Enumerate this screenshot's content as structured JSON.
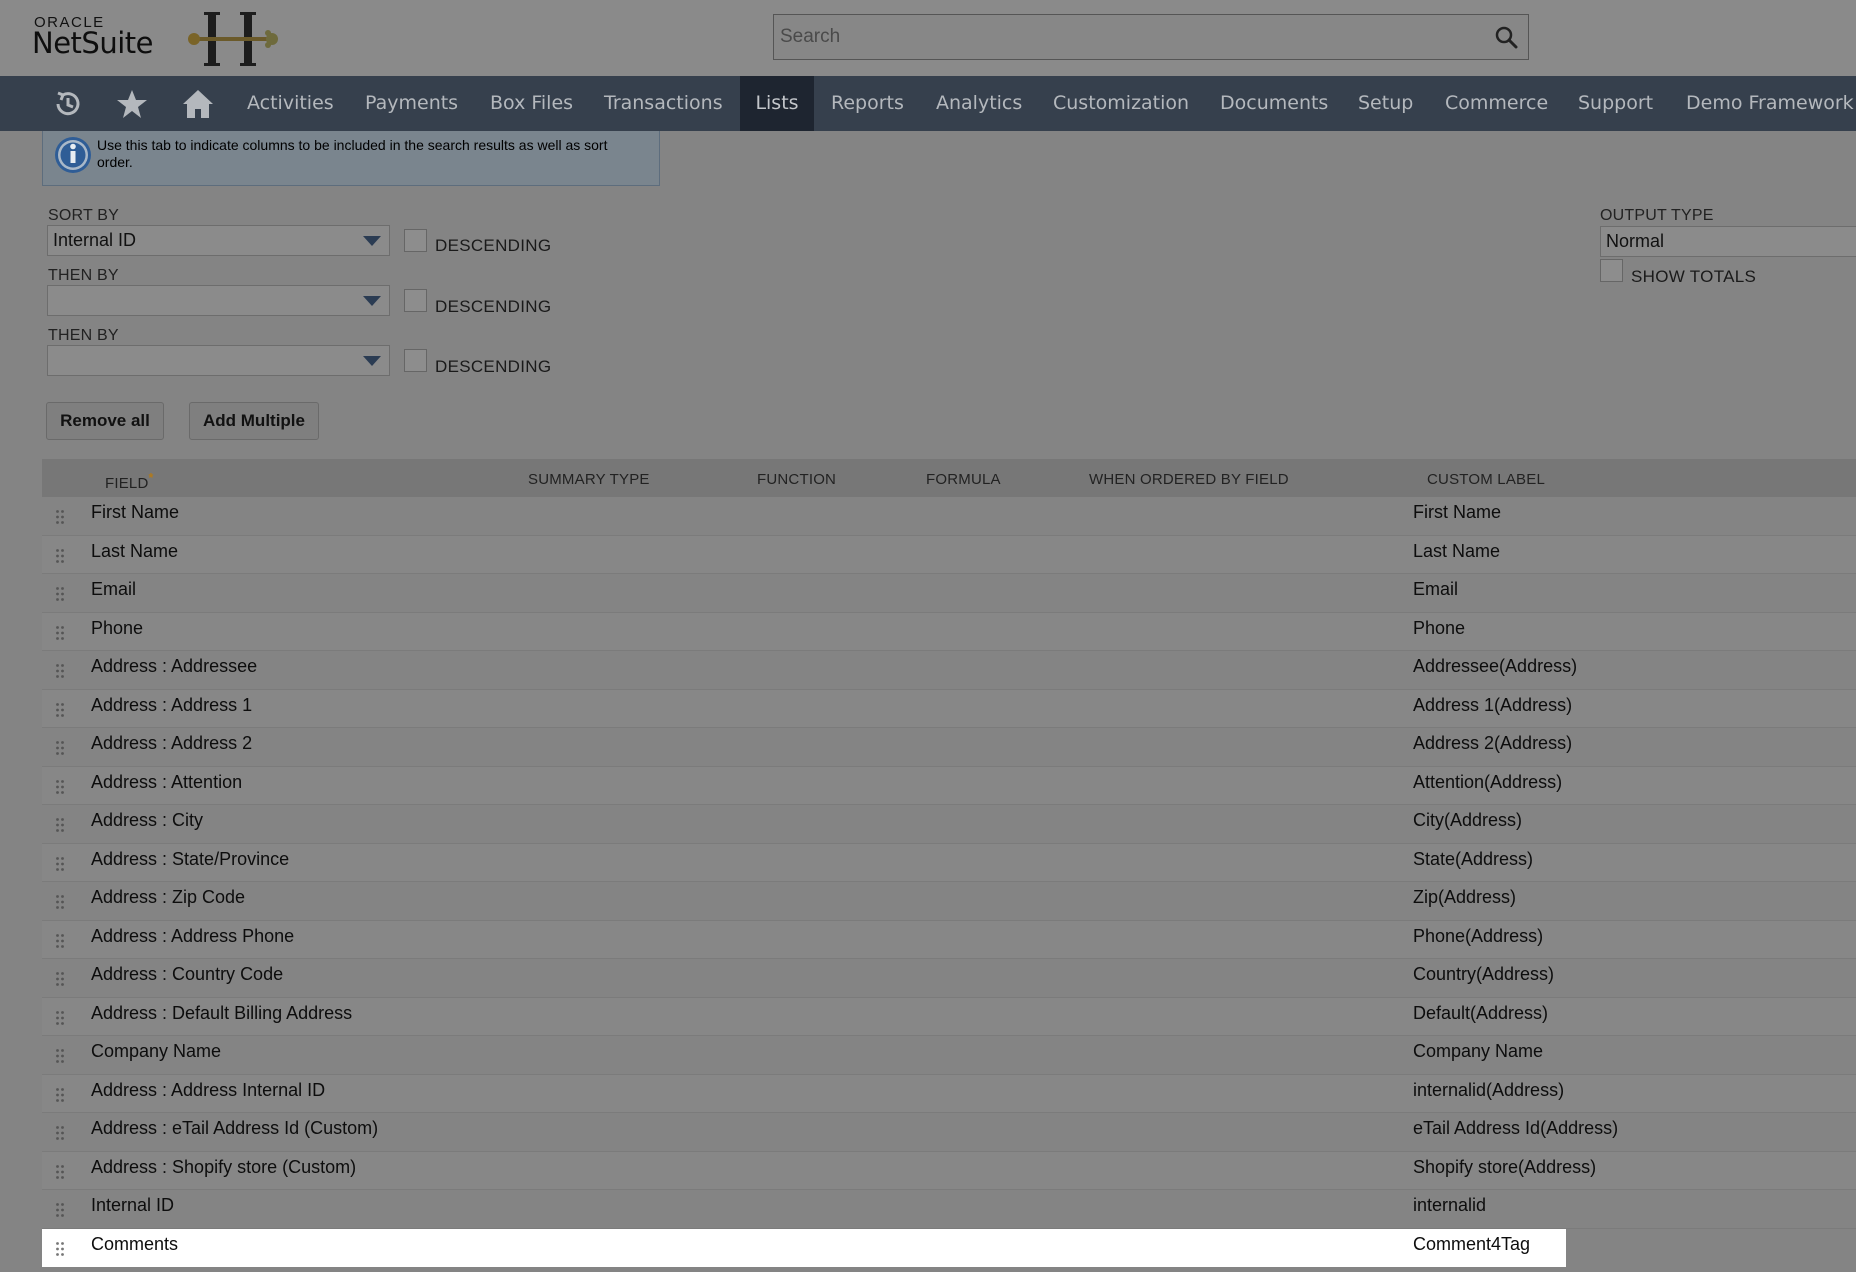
{
  "header": {
    "logo_brand": "ORACLE",
    "logo_product": "NetSuite",
    "search_placeholder": "Search"
  },
  "nav": {
    "icons": [
      "recent-records-icon",
      "star-icon",
      "home-icon"
    ],
    "items": [
      {
        "label": "Activities"
      },
      {
        "label": "Payments"
      },
      {
        "label": "Box Files"
      },
      {
        "label": "Transactions"
      },
      {
        "label": "Lists",
        "active": true
      },
      {
        "label": "Reports"
      },
      {
        "label": "Analytics"
      },
      {
        "label": "Customization"
      },
      {
        "label": "Documents"
      },
      {
        "label": "Setup"
      },
      {
        "label": "Commerce"
      },
      {
        "label": "Support"
      },
      {
        "label": "Demo Framework"
      }
    ]
  },
  "info": {
    "text": "Use this tab to indicate columns to be included in the search results as well as sort order."
  },
  "sort": {
    "sort_by_label": "SORT BY",
    "sort_by_value": "Internal ID",
    "then_by_label_1": "THEN BY",
    "then_by_value_1": "",
    "then_by_label_2": "THEN BY",
    "then_by_value_2": "",
    "descending_label": "DESCENDING"
  },
  "output": {
    "label": "OUTPUT TYPE",
    "value": "Normal",
    "show_totals_label": "SHOW TOTALS"
  },
  "buttons": {
    "remove_all": "Remove all",
    "add_multiple": "Add Multiple"
  },
  "table": {
    "headers": {
      "field": "FIELD",
      "required_mark": "*",
      "summary_type": "SUMMARY TYPE",
      "function": "FUNCTION",
      "formula": "FORMULA",
      "when_ordered_by_field": "WHEN ORDERED BY FIELD",
      "custom_label": "CUSTOM LABEL"
    },
    "rows": [
      {
        "field": "First Name",
        "label": "First Name"
      },
      {
        "field": "Last Name",
        "label": "Last Name"
      },
      {
        "field": "Email",
        "label": "Email"
      },
      {
        "field": "Phone",
        "label": "Phone"
      },
      {
        "field": "Address : Addressee",
        "label": "Addressee(Address)"
      },
      {
        "field": "Address : Address 1",
        "label": "Address 1(Address)"
      },
      {
        "field": "Address : Address 2",
        "label": "Address 2(Address)"
      },
      {
        "field": "Address : Attention",
        "label": "Attention(Address)"
      },
      {
        "field": "Address : City",
        "label": "City(Address)"
      },
      {
        "field": "Address : State/Province",
        "label": "State(Address)"
      },
      {
        "field": "Address : Zip Code",
        "label": "Zip(Address)"
      },
      {
        "field": "Address : Address Phone",
        "label": "Phone(Address)"
      },
      {
        "field": "Address : Country Code",
        "label": "Country(Address)"
      },
      {
        "field": "Address : Default Billing Address",
        "label": "Default(Address)"
      },
      {
        "field": "Company Name",
        "label": "Company Name"
      },
      {
        "field": "Address : Address Internal ID",
        "label": "internalid(Address)"
      },
      {
        "field": "Address : eTail Address Id (Custom)",
        "label": "eTail Address Id(Address)"
      },
      {
        "field": "Address : Shopify store (Custom)",
        "label": "Shopify store(Address)"
      },
      {
        "field": "Internal ID",
        "label": "internalid"
      },
      {
        "field": "Comments",
        "label": "Comment4Tag",
        "highlighted": true
      }
    ]
  }
}
